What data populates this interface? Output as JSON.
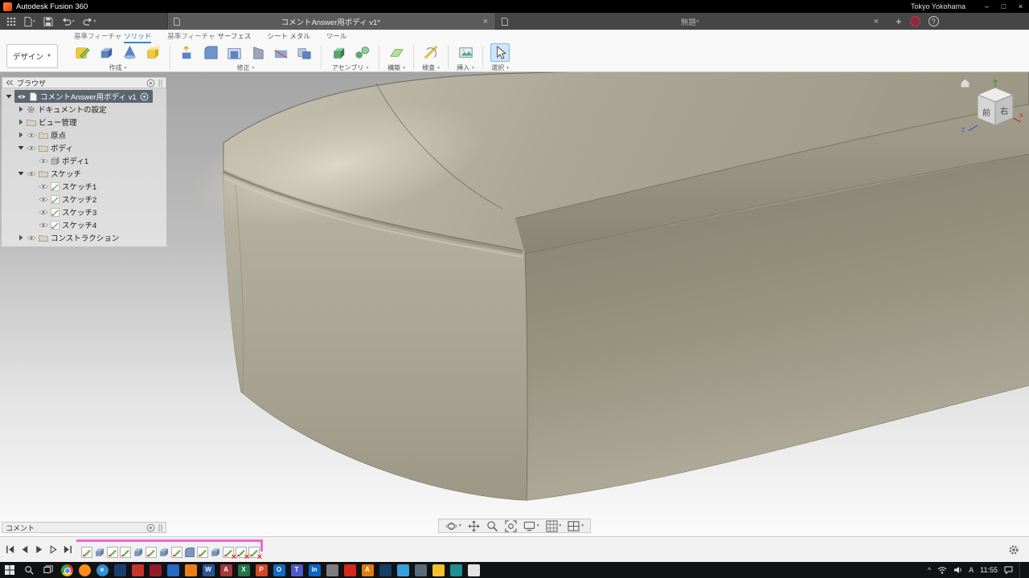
{
  "title_bar": {
    "app_title": "Autodesk Fusion 360",
    "account": "Tokyo Yokohama"
  },
  "window_controls": {
    "minimize": "–",
    "maximize": "□",
    "close": "×"
  },
  "doc_tabs": [
    {
      "label": "コメントAnswer用ボディ v1*",
      "active": true
    },
    {
      "label": "無題*",
      "active": false
    }
  ],
  "quick_actions": {
    "new_tab": "+",
    "help": "?"
  },
  "ribbon": {
    "workspace": "デザイン",
    "workspace_caret": "▼",
    "context_tabs": [
      {
        "prefix": "基準フィーチャ",
        "label": "ソリッド",
        "active": true
      },
      {
        "prefix": "基準フィーチャ",
        "label": "サーフェス",
        "active": false
      },
      {
        "prefix": "",
        "label": "シート メタル",
        "active": false
      },
      {
        "prefix": "",
        "label": "ツール",
        "active": false
      }
    ],
    "groups": [
      {
        "label": "作成",
        "icons": [
          "create-sketch",
          "extrude",
          "revolve",
          "new-component"
        ]
      },
      {
        "label": "修正",
        "icons": [
          "press-pull",
          "fillet",
          "shell",
          "draft",
          "split",
          "combine"
        ]
      },
      {
        "label": "アセンブリ",
        "icons": [
          "assemble",
          "joint"
        ]
      },
      {
        "label": "構築",
        "icons": [
          "construction-plane"
        ]
      },
      {
        "label": "検査",
        "icons": [
          "measure"
        ]
      },
      {
        "label": "挿入",
        "icons": [
          "insert-canvas"
        ]
      },
      {
        "label": "選択",
        "icons": [
          "select-cursor"
        ],
        "highlight": true
      }
    ]
  },
  "browser": {
    "header": "ブラウザ",
    "tree": [
      {
        "label": "コメントAnswer用ボディ v1",
        "level": 0,
        "arrow": "down",
        "eye": true,
        "icon": "doc",
        "root": true
      },
      {
        "label": "ドキュメントの設定",
        "level": 1,
        "arrow": "right",
        "eye": false,
        "icon": "gear",
        "root": false
      },
      {
        "label": "ビュー管理",
        "level": 1,
        "arrow": "right",
        "eye": false,
        "icon": "folder",
        "root": false
      },
      {
        "label": "原点",
        "level": 1,
        "arrow": "right",
        "eye": true,
        "icon": "folder",
        "root": false
      },
      {
        "label": "ボディ",
        "level": 1,
        "arrow": "down",
        "eye": true,
        "icon": "folder",
        "root": false
      },
      {
        "label": "ボディ1",
        "level": 2,
        "arrow": null,
        "eye": true,
        "icon": "body",
        "root": false
      },
      {
        "label": "スケッチ",
        "level": 1,
        "arrow": "down",
        "eye": true,
        "icon": "folder",
        "root": false
      },
      {
        "label": "スケッチ1",
        "level": 2,
        "arrow": null,
        "eye": true,
        "icon": "sketch",
        "root": false
      },
      {
        "label": "スケッチ2",
        "level": 2,
        "arrow": null,
        "eye": true,
        "icon": "sketch",
        "root": false
      },
      {
        "label": "スケッチ3",
        "level": 2,
        "arrow": null,
        "eye": true,
        "icon": "sketch",
        "root": false
      },
      {
        "label": "スケッチ4",
        "level": 2,
        "arrow": null,
        "eye": true,
        "icon": "sketch",
        "root": false
      },
      {
        "label": "コンストラクション",
        "level": 1,
        "arrow": "right",
        "eye": true,
        "icon": "folder",
        "root": false
      }
    ]
  },
  "viewcube": {
    "front_label": "前",
    "right_label": "右",
    "axis_x": "X",
    "axis_z": "Z"
  },
  "comments_bar": {
    "label": "コメント"
  },
  "navbar": {
    "icons": [
      "orbit",
      "pan",
      "zoom",
      "fit-view",
      "display-settings",
      "grid-settings",
      "viewports"
    ]
  },
  "timeline": {
    "playback": [
      "skip-to-start",
      "step-back",
      "play",
      "step-forward",
      "skip-to-end"
    ],
    "features": [
      {
        "icon": "sketch",
        "error": false
      },
      {
        "icon": "extrude",
        "error": false
      },
      {
        "icon": "sketch",
        "error": false
      },
      {
        "icon": "sketch",
        "error": false
      },
      {
        "icon": "extrude",
        "error": false
      },
      {
        "icon": "sketch",
        "error": false
      },
      {
        "icon": "extrude",
        "error": false
      },
      {
        "icon": "sketch",
        "error": false
      },
      {
        "icon": "fillet",
        "error": false
      },
      {
        "icon": "sketch",
        "error": false
      },
      {
        "icon": "extrude",
        "error": false
      },
      {
        "icon": "sketch",
        "error": true
      },
      {
        "icon": "sketch",
        "error": true
      },
      {
        "icon": "sketch",
        "error": true
      }
    ]
  },
  "taskbar": {
    "apps": [
      {
        "name": "chrome",
        "shape": "circle",
        "color": "#ea4335",
        "glyph": ""
      },
      {
        "name": "firefox",
        "shape": "circle",
        "color": "#ff8a1d",
        "glyph": ""
      },
      {
        "name": "edge",
        "shape": "circle",
        "color": "#2f8fd4",
        "glyph": "e"
      },
      {
        "name": "app-navy",
        "shape": "square",
        "color": "#1b3e6f",
        "glyph": ""
      },
      {
        "name": "app-red",
        "shape": "square",
        "color": "#c6352c",
        "glyph": ""
      },
      {
        "name": "app-crimson",
        "shape": "square",
        "color": "#8f1d2c",
        "glyph": ""
      },
      {
        "name": "app-blue",
        "shape": "square",
        "color": "#2668c5",
        "glyph": ""
      },
      {
        "name": "app-orange",
        "shape": "square",
        "color": "#e8801a",
        "glyph": ""
      },
      {
        "name": "word",
        "shape": "square",
        "color": "#2b579a",
        "glyph": "W"
      },
      {
        "name": "access",
        "shape": "square",
        "color": "#a4373a",
        "glyph": "A"
      },
      {
        "name": "excel",
        "shape": "square",
        "color": "#217346",
        "glyph": "X"
      },
      {
        "name": "powerpoint",
        "shape": "square",
        "color": "#d24726",
        "glyph": "P"
      },
      {
        "name": "outlook",
        "shape": "square",
        "color": "#0f6cbd",
        "glyph": "O"
      },
      {
        "name": "teams",
        "shape": "square",
        "color": "#5059c9",
        "glyph": "T"
      },
      {
        "name": "linkedin",
        "shape": "square",
        "color": "#0a66c2",
        "glyph": "in"
      },
      {
        "name": "app-gray",
        "shape": "square",
        "color": "#7d7d7d",
        "glyph": ""
      },
      {
        "name": "app-red2",
        "shape": "square",
        "color": "#d6281e",
        "glyph": ""
      },
      {
        "name": "autodesk",
        "shape": "square",
        "color": "#e07c10",
        "glyph": "A"
      },
      {
        "name": "app-darkblue",
        "shape": "square",
        "color": "#173f66",
        "glyph": ""
      },
      {
        "name": "app-skyblue",
        "shape": "square",
        "color": "#3aa0dd",
        "glyph": ""
      },
      {
        "name": "app-slate",
        "shape": "square",
        "color": "#5a6b7a",
        "glyph": ""
      },
      {
        "name": "explorer",
        "shape": "square",
        "color": "#f5c02f",
        "glyph": ""
      },
      {
        "name": "app-teal",
        "shape": "square",
        "color": "#1f8f8f",
        "glyph": ""
      },
      {
        "name": "app-white",
        "shape": "square",
        "color": "#e4e4e4",
        "glyph": ""
      }
    ],
    "tray": {
      "ime": "A",
      "time": "11:55"
    }
  }
}
